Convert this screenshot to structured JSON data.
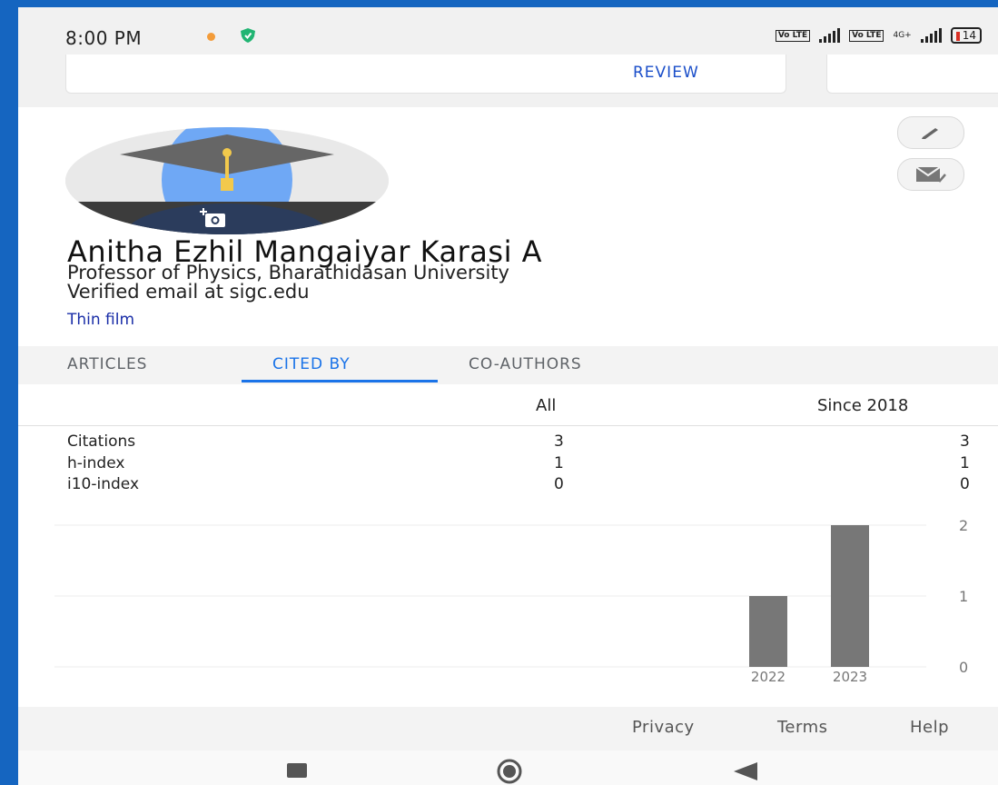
{
  "status_bar": {
    "time": "8:00 PM",
    "volte1": "Vo LTE",
    "volte2": "Vo LTE",
    "network": "4G+",
    "battery": "14"
  },
  "review": {
    "label": "REVIEW"
  },
  "profile": {
    "name": "Anitha Ezhil Mangaiyar Karasi A",
    "affiliation": "Professor of Physics, Bharathidasan University",
    "email": "Verified email at sigc.edu",
    "interest": "Thin film"
  },
  "tabs": [
    {
      "label": "ARTICLES"
    },
    {
      "label": "CITED BY"
    },
    {
      "label": "CO-AUTHORS"
    }
  ],
  "table": {
    "headers": {
      "all": "All",
      "since": "Since 2018"
    },
    "rows": [
      {
        "label": "Citations",
        "all": "3",
        "since": "3"
      },
      {
        "label": "h-index",
        "all": "1",
        "since": "1"
      },
      {
        "label": "i10-index",
        "all": "0",
        "since": "0"
      }
    ]
  },
  "chart_data": {
    "type": "bar",
    "categories": [
      "2022",
      "2023"
    ],
    "values": [
      1,
      2
    ],
    "ylim": [
      0,
      2
    ],
    "yticks": [
      "0",
      "1",
      "2"
    ],
    "grid": true
  },
  "footer": {
    "privacy": "Privacy",
    "terms": "Terms",
    "help": "Help"
  },
  "colors": {
    "accent": "#1a73e8",
    "link": "#1a2ea8",
    "bar": "#777777"
  }
}
